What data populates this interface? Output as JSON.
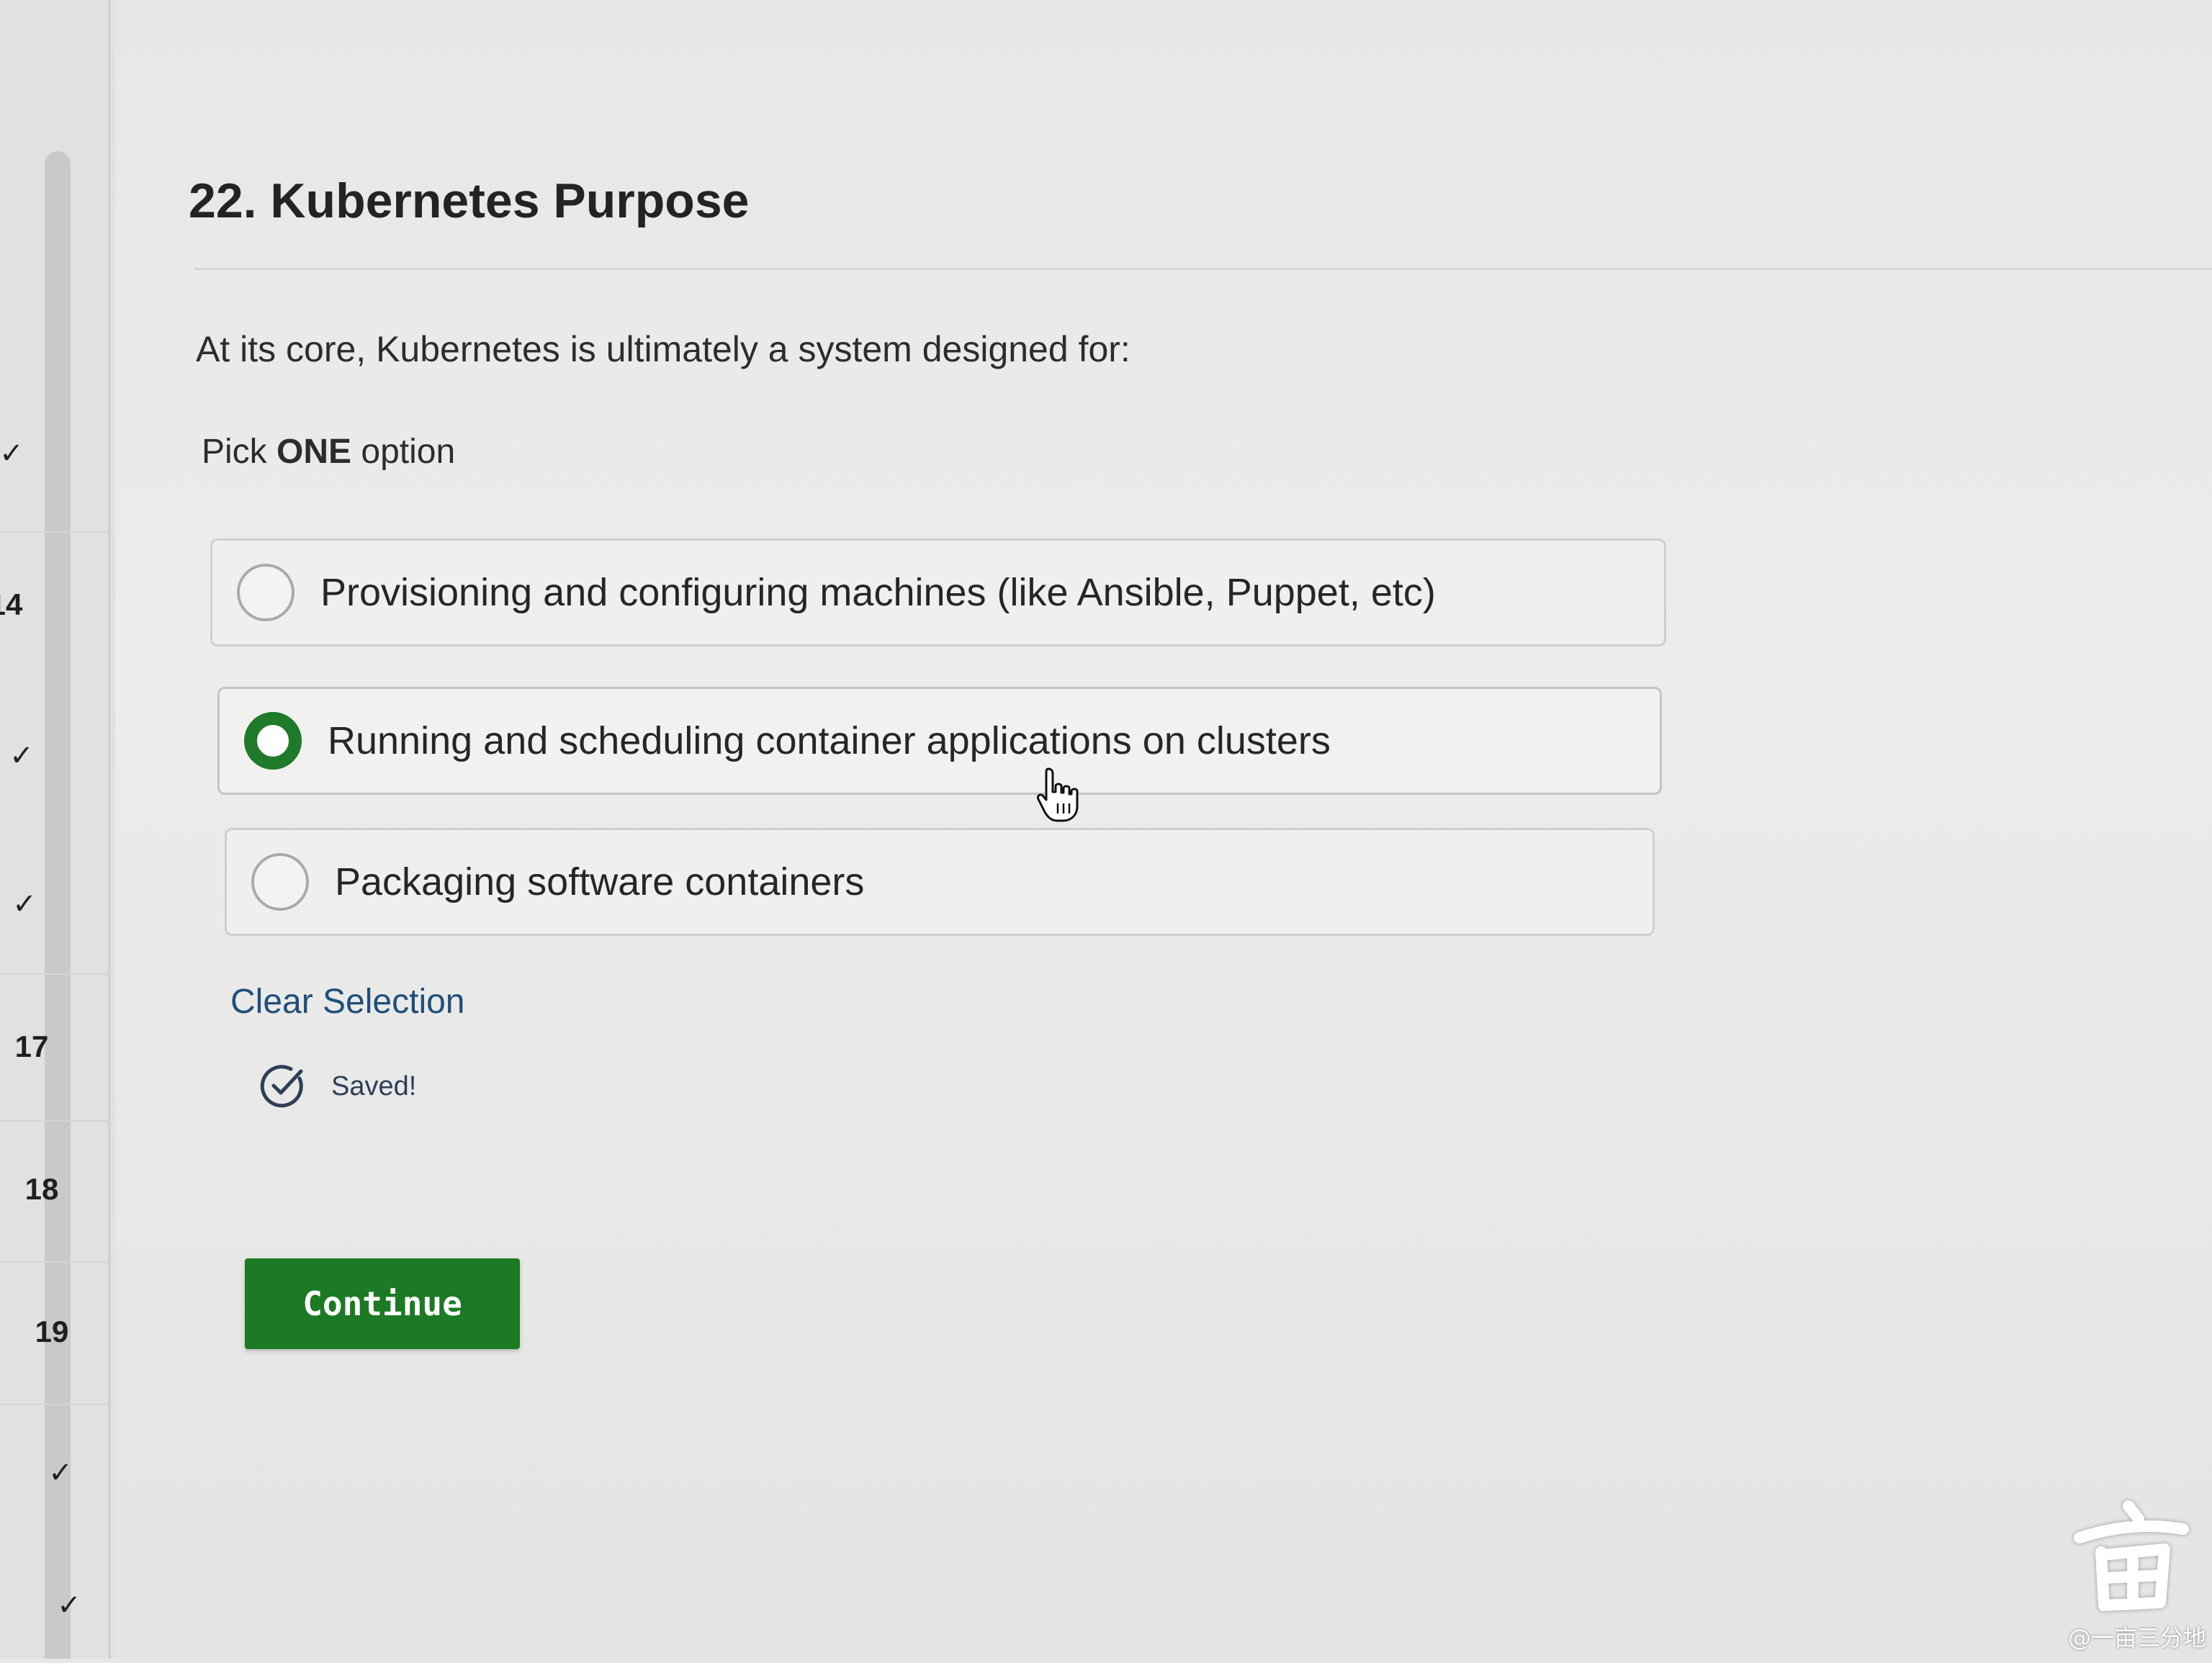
{
  "sidebar": {
    "items": [
      {
        "type": "check",
        "glyph": "✓"
      },
      {
        "type": "number",
        "label": "14"
      },
      {
        "type": "check",
        "glyph": "✓"
      },
      {
        "type": "check",
        "glyph": "✓"
      },
      {
        "type": "number",
        "label": "17"
      },
      {
        "type": "number",
        "label": "18"
      },
      {
        "type": "number",
        "label": "19"
      },
      {
        "type": "check",
        "glyph": "✓"
      },
      {
        "type": "check",
        "glyph": "✓"
      }
    ]
  },
  "question": {
    "title": "22. Kubernetes Purpose",
    "prompt": "At its core, Kubernetes is ultimately a system designed for:",
    "instruction_prefix": "Pick",
    "instruction_emphasis": "ONE",
    "instruction_suffix": "option"
  },
  "options": [
    {
      "label": "Provisioning and configuring machines (like Ansible, Puppet, etc)",
      "selected": false
    },
    {
      "label": "Running and scheduling container applications on clusters",
      "selected": true
    },
    {
      "label": "Packaging software containers",
      "selected": false
    }
  ],
  "actions": {
    "clear_label": "Clear Selection",
    "saved_label": "Saved!",
    "continue_label": "Continue"
  },
  "colors": {
    "accent_green": "#1b7a23",
    "radio_selected": "#1f7a2a",
    "link_blue": "#1f4e7a"
  },
  "icons": {
    "saved": "check-circle-icon",
    "cursor": "hand-pointer-icon",
    "rail_check": "check-icon"
  },
  "watermark": {
    "text": "@一亩三分地"
  }
}
